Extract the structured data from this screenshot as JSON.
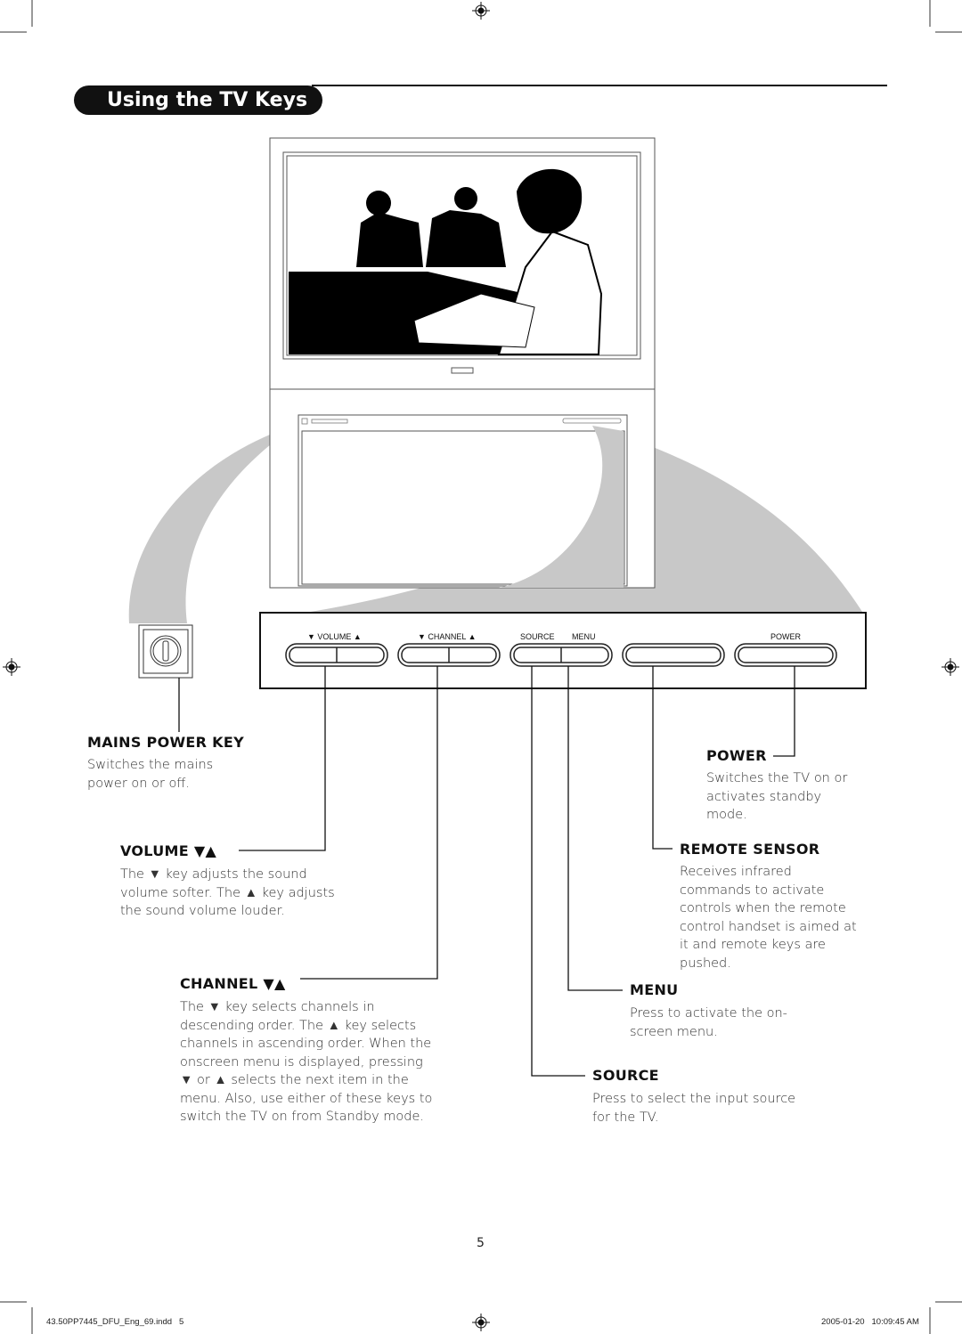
{
  "title": "Using the TV Keys",
  "panel_labels": {
    "volume": "▼ VOLUME ▲",
    "channel": "▼ CHANNEL ▲",
    "source": "SOURCE",
    "menu": "MENU",
    "power": "POWER"
  },
  "callouts": {
    "mains": {
      "heading": "MAINS POWER KEY",
      "text": "Switches the mains power on or off."
    },
    "volume": {
      "heading": "VOLUME ▼▲",
      "text": "The ▼ key adjusts the sound volume softer. The ▲ key adjusts the sound volume louder."
    },
    "channel": {
      "heading": "CHANNEL ▼▲",
      "text": "The ▼ key selects channels in descending order. The ▲ key selects channels in ascending order. When the onscreen menu is displayed, pressing ▼ or ▲ selects the next item in the menu. Also, use either of these keys to switch the TV on from Standby mode."
    },
    "power": {
      "heading": "POWER",
      "text": "Switches the TV on or activates standby mode."
    },
    "remote": {
      "heading": "REMOTE SENSOR",
      "text": "Receives infrared commands to activate controls when the remote control handset is aimed at it and remote keys are pushed."
    },
    "menu": {
      "heading": "MENU",
      "text": "Press to activate the on-screen menu."
    },
    "source": {
      "heading": "SOURCE",
      "text": "Press to select the input source for the TV."
    }
  },
  "page_number": "5",
  "footer": {
    "file": "43.50PP7445_DFU_Eng_69.indd   5",
    "timestamp": "2005-01-20   10:09:45 AM"
  },
  "icons": [
    "registration-mark-icon",
    "power-knob-icon"
  ]
}
